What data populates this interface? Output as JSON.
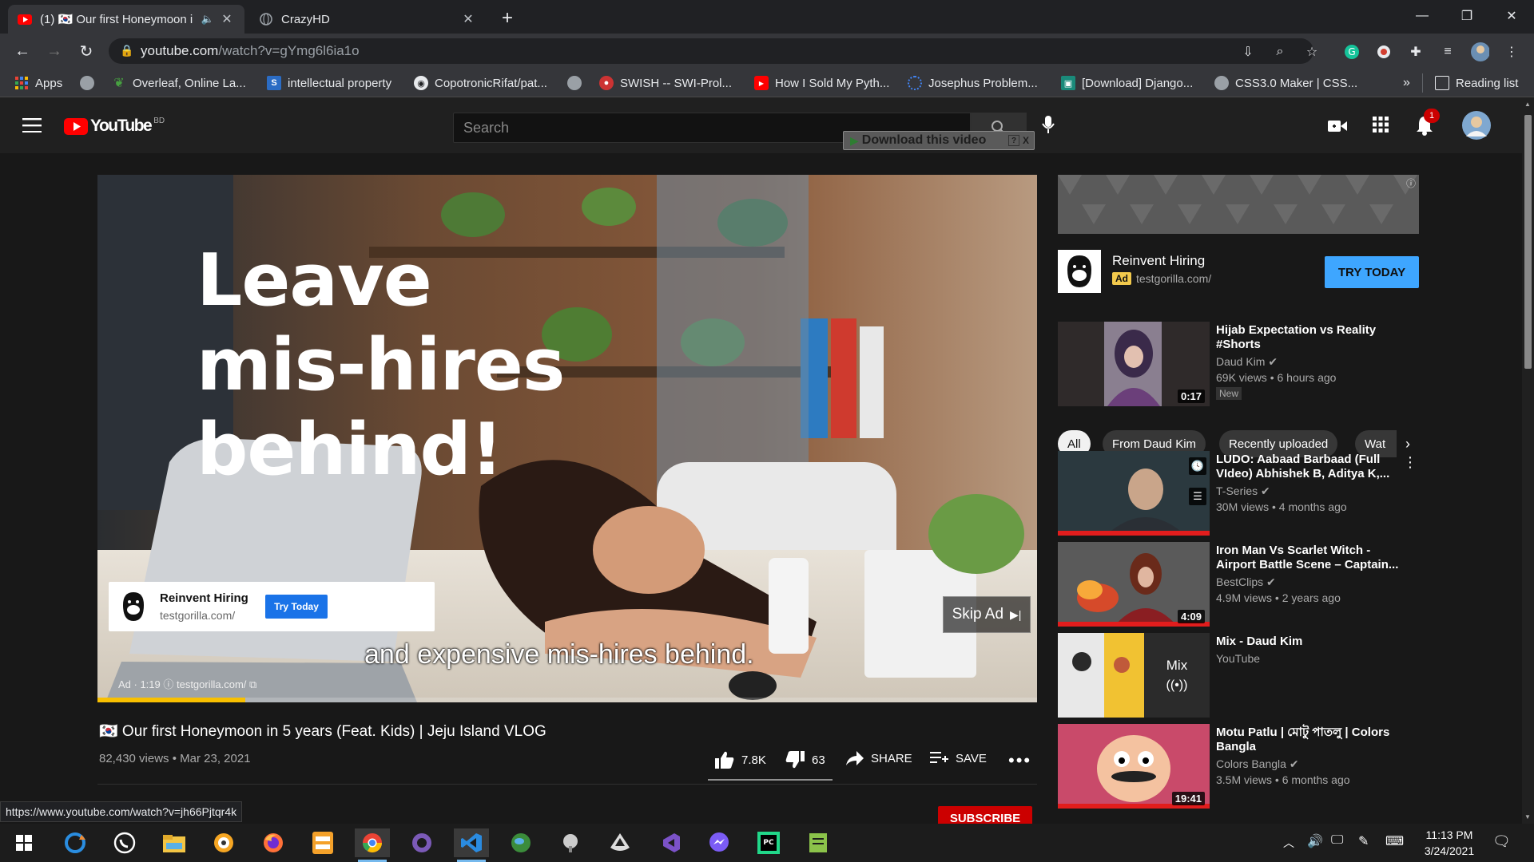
{
  "tabs": [
    {
      "title": "(1) 🇰🇷 Our first Honeymoon i",
      "active": true
    },
    {
      "title": "CrazyHD",
      "active": false
    }
  ],
  "omnibox": {
    "host": "youtube.com",
    "path": "/watch?v=gYmg6l6ia1o"
  },
  "bookmarks": [
    {
      "label": "Apps"
    },
    {
      "label": "Overleaf, Online La..."
    },
    {
      "label": "intellectual property"
    },
    {
      "label": "CopotronicRifat/pat..."
    },
    {
      "label": "SWISH -- SWI-Prol..."
    },
    {
      "label": "How I Sold My Pyth..."
    },
    {
      "label": "Josephus Problem..."
    },
    {
      "label": "[Download] Django..."
    },
    {
      "label": "CSS3.0 Maker | CSS..."
    },
    {
      "label": "Reading list"
    }
  ],
  "bookmarks_more": "»",
  "youtube": {
    "logo": "YouTube",
    "country": "BD",
    "search_placeholder": "Search",
    "download_bar": "Download this video",
    "download_help": "?",
    "download_close": "X",
    "notifications": "1"
  },
  "player": {
    "ad_headline": [
      "Leave",
      "mis-hires",
      "behind!"
    ],
    "ad_card_title": "Reinvent Hiring",
    "ad_card_url": "testgorilla.com/",
    "ad_card_button": "Try Today",
    "skip": "Skip Ad",
    "caption": "and expensive mis-hires behind.",
    "ad_meta": "Ad · 1:19 ⓘ  testgorilla.com/ ⧉",
    "progress": 0.157
  },
  "video": {
    "title": "🇰🇷 Our first Honeymoon in 5 years (Feat. Kids) | Jeju Island VLOG",
    "views": "82,430 views • Mar 23, 2021",
    "likes": "7.8K",
    "dislikes": "63",
    "share": "SHARE",
    "save": "SAVE",
    "subscribe": "SUBSCRIBE"
  },
  "sidebar_ad": {
    "title": "Reinvent Hiring",
    "badge": "Ad",
    "url": "testgorilla.com/",
    "button": "TRY TODAY"
  },
  "chips": [
    "All",
    "From Daud Kim",
    "Recently uploaded",
    "Wat"
  ],
  "recommendations": [
    {
      "title": "Hijab Expectation vs Reality #Shorts",
      "channel": "Daud Kim",
      "verified": true,
      "meta": "69K views • 6 hours ago",
      "badge": "New",
      "duration": "0:17"
    },
    {
      "title": "LUDO: Aabaad Barbaad (Full VIdeo) Abhishek B, Aditya K,...",
      "channel": "T-Series",
      "verified": true,
      "meta": "30M views • 4 months ago",
      "duration": ""
    },
    {
      "title": "Iron Man Vs Scarlet Witch - Airport Battle Scene – Captain...",
      "channel": "BestClips",
      "verified": true,
      "meta": "4.9M views • 2 years ago",
      "duration": "4:09"
    },
    {
      "title": "Mix - Daud Kim",
      "channel": "YouTube",
      "verified": false,
      "meta": "",
      "duration": "",
      "mix_label": "Mix"
    },
    {
      "title": "Motu Patlu | মোটু পাতলু | Colors Bangla",
      "channel": "Colors Bangla",
      "verified": true,
      "meta": "3.5M views • 6 months ago",
      "duration": "19:41"
    }
  ],
  "status_url": "https://www.youtube.com/watch?v=jh66Pjtqr4k",
  "clock": {
    "time": "11:13 PM",
    "date": "3/24/2021"
  }
}
